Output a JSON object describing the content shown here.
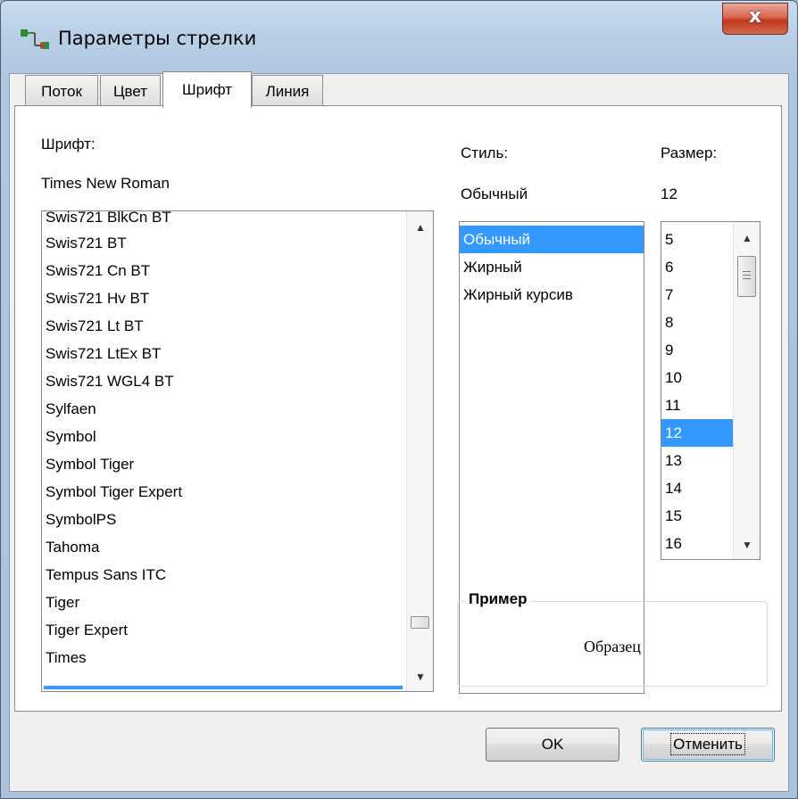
{
  "window": {
    "title": "Параметры стрелки",
    "close_glyph": "x"
  },
  "tabs": [
    {
      "label": "Поток"
    },
    {
      "label": "Цвет"
    },
    {
      "label": "Шрифт",
      "active": true
    },
    {
      "label": "Линия"
    }
  ],
  "font": {
    "label": "Шрифт:",
    "current": "Times New Roman",
    "partial_top_item": "Swis721 BlkCn BT",
    "items": [
      "Swis721 BT",
      "Swis721 Cn BT",
      "Swis721 Hv BT",
      "Swis721 Lt BT",
      "Swis721 LtEx BT",
      "Swis721 WGL4 BT",
      "Sylfaen",
      "Symbol",
      "Symbol Tiger",
      "Symbol Tiger Expert",
      "SymbolPS",
      "Tahoma",
      "Tempus Sans ITC",
      "Tiger",
      "Tiger Expert",
      "Times"
    ]
  },
  "style": {
    "label": "Стиль:",
    "current": "Обычный",
    "items": [
      "Обычный",
      "Жирный",
      "Жирный курсив"
    ],
    "selected_index": 0
  },
  "size": {
    "label": "Размер:",
    "current": "12",
    "items": [
      "5",
      "6",
      "7",
      "8",
      "9",
      "10",
      "11",
      "12",
      "13",
      "14",
      "15",
      "16"
    ],
    "selected_index": 7
  },
  "sample": {
    "group_label": "Пример",
    "text": "Образец"
  },
  "buttons": {
    "ok": "OK",
    "cancel": "Отменить"
  },
  "colors": {
    "selection": "#3399ff",
    "close_button": "#c2361f"
  }
}
